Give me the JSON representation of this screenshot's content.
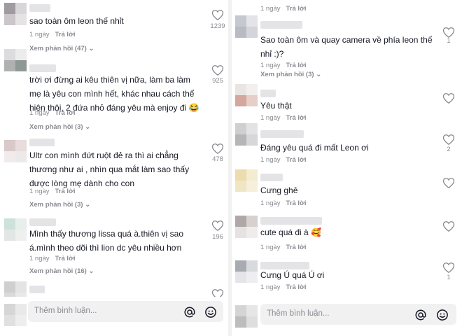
{
  "left_panel": {
    "comments": [
      {
        "text": "sao toàn ôm leon thế nhỉt",
        "time": "1 ngày",
        "reply": "Trả lời",
        "likes": "1239",
        "replies": "Xem phản hồi (47)"
      },
      {
        "text": "trời ơi đừng ai kêu thiên vị nữa, làm ba làm mẹ là yêu con mình hết, khác nhau cách thể hiện thôi, 2 đứa nhỏ đáng yêu mà enjoy đi 😂",
        "time": "1 ngày",
        "reply": "Trả lời",
        "likes": "925",
        "replies": "Xem phản hồi (3)"
      },
      {
        "text": "Ultr con mình đứt ruột đẻ ra thì ai chẳng thương như ai , nhìn qua mắt làm sao thấy được lòng mẹ dành cho con",
        "time": "1 ngày",
        "reply": "Trả lời",
        "likes": "478",
        "replies": "Xem phản hồi (3)"
      },
      {
        "text": "Mình thấy thương lissa quá à.thiên vị sao á.mình theo dõi thì lion dc yêu nhiều hơn",
        "time": "1 ngày",
        "reply": "Trả lời",
        "likes": "196",
        "replies": "Xem phản hồi (16)"
      }
    ],
    "input_placeholder": "Thêm bình luận..."
  },
  "right_panel": {
    "top_meta": {
      "time": "1 ngày",
      "reply": "Trả lời"
    },
    "comments": [
      {
        "text": "Sao toàn ôm và quay camera về phía leon thế nhỉ :)?",
        "time": "1 ngày",
        "reply": "Trả lời",
        "likes": "1",
        "replies": "Xem phản hồi (3)"
      },
      {
        "text": "Yêu thật",
        "time": "1 ngày",
        "reply": "Trả lời",
        "likes": ""
      },
      {
        "text": "Đáng yêu quá đi mất Leon ơi",
        "time": "1 ngày",
        "reply": "Trả lời",
        "likes": "2"
      },
      {
        "text": "Cưng ghê",
        "time": "1 ngày",
        "reply": "Trả lời",
        "likes": ""
      },
      {
        "text": "cute quá đi à 🥰",
        "time": "1 ngày",
        "reply": "Trả lời",
        "likes": ""
      },
      {
        "text": "Cưng Ú quá Ú ơi",
        "time": "1 ngày",
        "reply": "Trả lời",
        "likes": "1"
      }
    ],
    "input_placeholder": "Thêm bình luận..."
  },
  "colors": {
    "text": "#161823",
    "muted": "#8a8b91",
    "input_bg": "#f1f1f2"
  },
  "icons": [
    "heart-icon",
    "at-icon",
    "emoji-icon",
    "chevron-down-icon"
  ]
}
